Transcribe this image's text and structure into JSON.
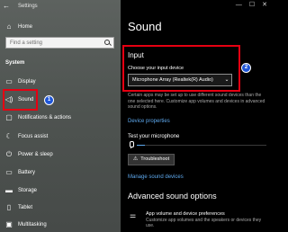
{
  "window": {
    "title": "Settings",
    "controls": [
      "—",
      "☐",
      "✕"
    ]
  },
  "sidebar": {
    "home_label": "Home",
    "search_placeholder": "Find a setting",
    "section_label": "System",
    "items": [
      {
        "label": "Display",
        "icon": "display-icon",
        "glyph": "▭"
      },
      {
        "label": "Sound",
        "icon": "speaker-icon",
        "glyph": "◁)"
      },
      {
        "label": "Notifications & actions",
        "icon": "notifications-icon",
        "glyph": "▢"
      },
      {
        "label": "Focus assist",
        "icon": "moon-icon",
        "glyph": "☾"
      },
      {
        "label": "Power & sleep",
        "icon": "power-icon",
        "glyph": "⏻"
      },
      {
        "label": "Battery",
        "icon": "battery-icon",
        "glyph": "▭"
      },
      {
        "label": "Storage",
        "icon": "storage-icon",
        "glyph": "▬"
      },
      {
        "label": "Tablet",
        "icon": "tablet-icon",
        "glyph": "▯"
      },
      {
        "label": "Multitasking",
        "icon": "multitasking-icon",
        "glyph": "▣"
      }
    ],
    "selected_item": "Sound"
  },
  "annotations": {
    "badge_1": "1",
    "badge_2": "2",
    "highlight_color": "#e60012",
    "badge_color": "#1f56d8"
  },
  "main": {
    "page_title": "Sound",
    "input": {
      "heading": "Input",
      "choose_label": "Choose your input device",
      "selected_device": "Microphone Array (Realtek(R) Audio)",
      "help_text": "Certain apps may be set up to use different sound devices than the one selected here. Customize app volumes and devices in advanced sound options.",
      "device_properties_link": "Device properties",
      "test_label": "Test your microphone",
      "mic_level": 0.06,
      "troubleshoot_label": "Troubleshoot",
      "manage_link": "Manage sound devices"
    },
    "advanced": {
      "heading": "Advanced sound options",
      "item_title": "App volume and device preferences",
      "item_description": "Customize app volumes and the speakers or devices they use."
    }
  },
  "colors": {
    "link": "#5ea9ee",
    "background_dark": "#000000"
  }
}
